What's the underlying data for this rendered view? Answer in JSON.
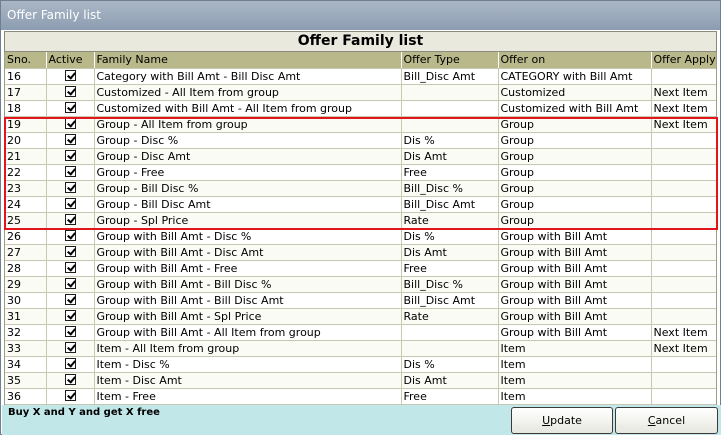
{
  "window": {
    "title": "Offer Family list"
  },
  "list_title": "Offer Family list",
  "columns": [
    "Sno.",
    "Active",
    "Family Name",
    "Offer Type",
    "Offer on",
    "Offer Apply"
  ],
  "rows": [
    {
      "sno": "16",
      "active": true,
      "family": "Category with Bill Amt - Bill Disc Amt",
      "type": "Bill_Disc Amt",
      "on": "CATEGORY with Bill Amt",
      "apply": ""
    },
    {
      "sno": "17",
      "active": true,
      "family": "Customized - All Item from group",
      "type": "",
      "on": "Customized",
      "apply": "Next Item"
    },
    {
      "sno": "18",
      "active": true,
      "family": "Customized with Bill Amt - All Item from group",
      "type": "",
      "on": "Customized with Bill Amt",
      "apply": "Next Item"
    },
    {
      "sno": "19",
      "active": true,
      "family": "Group - All Item from group",
      "type": "",
      "on": "Group",
      "apply": "Next Item"
    },
    {
      "sno": "20",
      "active": true,
      "family": "Group - Disc %",
      "type": "Dis %",
      "on": "Group",
      "apply": ""
    },
    {
      "sno": "21",
      "active": true,
      "family": "Group - Disc Amt",
      "type": "Dis Amt",
      "on": "Group",
      "apply": ""
    },
    {
      "sno": "22",
      "active": true,
      "family": "Group - Free",
      "type": "Free",
      "on": "Group",
      "apply": ""
    },
    {
      "sno": "23",
      "active": true,
      "family": "Group - Bill Disc %",
      "type": "Bill_Disc %",
      "on": "Group",
      "apply": ""
    },
    {
      "sno": "24",
      "active": true,
      "family": "Group - Bill Disc Amt",
      "type": "Bill_Disc Amt",
      "on": "Group",
      "apply": ""
    },
    {
      "sno": "25",
      "active": true,
      "family": "Group - Spl Price",
      "type": "Rate",
      "on": "Group",
      "apply": ""
    },
    {
      "sno": "26",
      "active": true,
      "family": "Group with Bill Amt - Disc %",
      "type": "Dis %",
      "on": "Group with Bill Amt",
      "apply": ""
    },
    {
      "sno": "27",
      "active": true,
      "family": "Group with Bill Amt - Disc Amt",
      "type": "Dis Amt",
      "on": "Group with Bill Amt",
      "apply": ""
    },
    {
      "sno": "28",
      "active": true,
      "family": "Group with Bill Amt - Free",
      "type": "Free",
      "on": "Group with Bill Amt",
      "apply": ""
    },
    {
      "sno": "29",
      "active": true,
      "family": "Group with Bill Amt - Bill Disc %",
      "type": "Bill_Disc %",
      "on": "Group with Bill Amt",
      "apply": ""
    },
    {
      "sno": "30",
      "active": true,
      "family": "Group with Bill Amt - Bill Disc Amt",
      "type": "Bill_Disc Amt",
      "on": "Group with Bill Amt",
      "apply": ""
    },
    {
      "sno": "31",
      "active": true,
      "family": "Group with Bill Amt - Spl Price",
      "type": "Rate",
      "on": "Group with Bill Amt",
      "apply": ""
    },
    {
      "sno": "32",
      "active": true,
      "family": "Group with Bill Amt - All Item from group",
      "type": "",
      "on": "Group with Bill Amt",
      "apply": "Next Item"
    },
    {
      "sno": "33",
      "active": true,
      "family": "Item - All Item from group",
      "type": "",
      "on": "Item",
      "apply": "Next Item"
    },
    {
      "sno": "34",
      "active": true,
      "family": "Item - Disc %",
      "type": "Dis %",
      "on": "Item",
      "apply": ""
    },
    {
      "sno": "35",
      "active": true,
      "family": "Item - Disc Amt",
      "type": "Dis Amt",
      "on": "Item",
      "apply": ""
    },
    {
      "sno": "36",
      "active": true,
      "family": "Item - Free",
      "type": "Free",
      "on": "Item",
      "apply": ""
    }
  ],
  "status_text": "Buy X and Y and get X free",
  "buttons": {
    "update_mnemonic": "U",
    "update_rest": "pdate",
    "cancel_mnemonic": "C",
    "cancel_rest": "ancel"
  },
  "colors": {
    "header_bg": "#b8b88a",
    "highlight_border": "#e0161c",
    "status_bg": "#c2e7e8",
    "titlebar": "#a9b7c6"
  },
  "icons": {
    "active_cell": "checkbox-checked-icon"
  }
}
